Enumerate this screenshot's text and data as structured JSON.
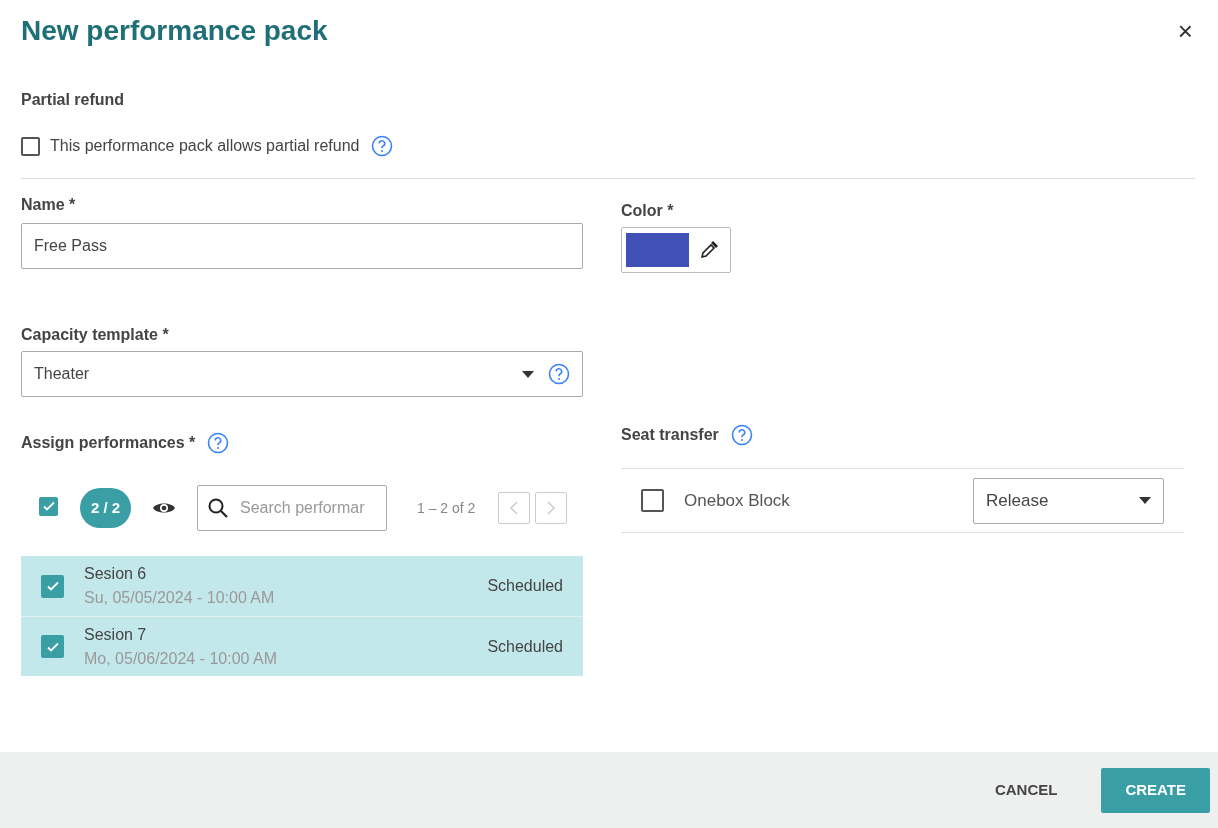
{
  "dialog": {
    "title": "New performance pack",
    "close": "×"
  },
  "partial_refund": {
    "heading": "Partial refund",
    "checkbox_label": "This performance pack allows partial refund",
    "checked": false
  },
  "name": {
    "label": "Name *",
    "value": "Free Pass"
  },
  "color": {
    "label": "Color *",
    "color": "#3f51b5"
  },
  "capacity_template": {
    "label": "Capacity template *",
    "value": "Theater"
  },
  "assign_performances": {
    "label": "Assign performances *",
    "select_all_checked": true,
    "count_badge": "2 / 2",
    "search_placeholder": "Search performar",
    "pagination": "1 – 2 of 2",
    "rows": [
      {
        "name": "Sesion 6",
        "date": "Su, 05/05/2024 - 10:00 AM",
        "status": "Scheduled",
        "selected": true
      },
      {
        "name": "Sesion 7",
        "date": "Mo, 05/06/2024 - 10:00 AM",
        "status": "Scheduled",
        "selected": true
      }
    ]
  },
  "seat_transfer": {
    "label": "Seat transfer",
    "items": [
      {
        "label": "Onebox Block",
        "checked": false,
        "action": "Release"
      }
    ]
  },
  "footer": {
    "buttons": [
      {
        "label": "CANCEL",
        "kind": "text"
      },
      {
        "label": "CREATE",
        "kind": "primary"
      }
    ]
  }
}
